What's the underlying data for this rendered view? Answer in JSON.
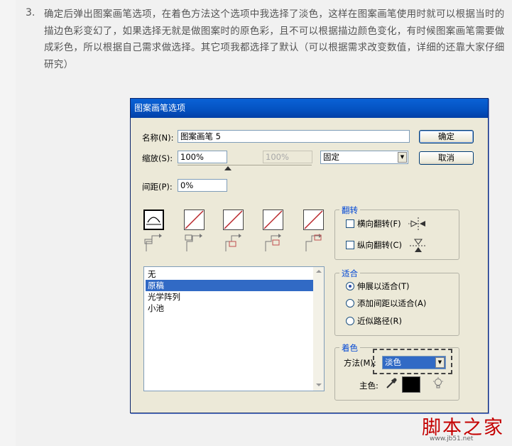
{
  "article": {
    "step_number": "3.",
    "step_text": "确定后弹出图案画笔选项，在着色方法这个选项中我选择了淡色，这样在图案画笔使用时就可以根据当时的描边色彩变幻了，如果选择无就是做图案时的原色彩，且不可以根据描边颜色变化，有时候图案画笔需要做成彩色，所以根据自己需求做选择。其它项我都选择了默认（可以根据需求改变数值，详细的还靠大家仔细研究）"
  },
  "dialog": {
    "title": "图案画笔选项",
    "name_label": "名称(N):",
    "name_value": "图案画笔 5",
    "scale_label": "缩放(S):",
    "scale_value": "100%",
    "scale_value2": "100%",
    "scale_mode": "固定",
    "spacing_label": "间距(P):",
    "spacing_value": "0%",
    "ok_button": "确定",
    "cancel_button": "取消",
    "flip": {
      "title": "翻转",
      "horizontal": "横向翻转(F)",
      "vertical": "纵向翻转(C)"
    },
    "pattern_list": {
      "items": [
        "无",
        "原稿",
        "光学阵列",
        "小池"
      ],
      "selected_index": 1
    },
    "fit": {
      "title": "适合",
      "options": [
        "伸展以适合(T)",
        "添加间距以适合(A)",
        "近似路径(R)"
      ],
      "selected_index": 0
    },
    "colorization": {
      "title": "着色",
      "method_label": "方法(M):",
      "method_value": "淡色",
      "key_color_label": "主色:",
      "key_color": "#000000"
    }
  },
  "watermark": {
    "text": "脚本之家",
    "url": "www.jb51.net"
  },
  "colors": {
    "titlebar": "#0451c0",
    "selection": "#316ac5",
    "tile_stroke": "#b8262a",
    "watermark": "#c40000"
  }
}
